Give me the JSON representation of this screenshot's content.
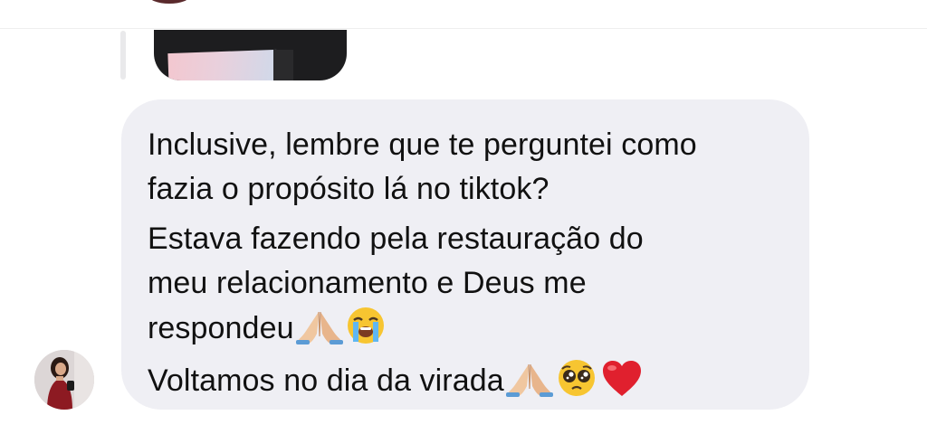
{
  "message": {
    "lines": [
      "Inclusive, lembre que te perguntei como",
      "fazia o propósito lá no tiktok?",
      "Estava fazendo pela restauração do",
      "meu relacionamento e Deus me",
      "respondeu",
      "Voltamos no dia da virada"
    ],
    "emoji": {
      "line5": [
        "folded-hands",
        "loudly-crying-face"
      ],
      "line6": [
        "folded-hands",
        "pleading-face",
        "red-heart"
      ]
    }
  },
  "colors": {
    "bubble": "#efeff4",
    "text": "#111111",
    "heart": "#e0202e",
    "emoji_yellow": "#f7c531",
    "skin": "#f0c7a0"
  }
}
